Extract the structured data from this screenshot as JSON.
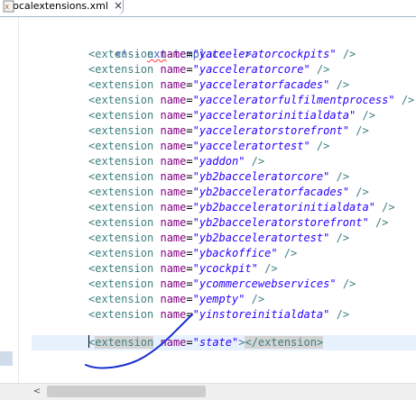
{
  "tab": {
    "title": "*localextensions.xml",
    "close": "×",
    "icon": "xml-file-icon"
  },
  "editor": {
    "comment": "<!-- ext-template -->",
    "extensions": [
      "yacceleratorcockpits",
      "yacceleratorcore",
      "yacceleratorfacades",
      "yacceleratorfulfilmentprocess",
      "yacceleratorinitialdata",
      "yacceleratorstorefront",
      "yacceleratortest",
      "yaddon",
      "yb2bacceleratorcore",
      "yb2bacceleratorfacades",
      "yb2bacceleratorinitialdata",
      "yb2bacceleratorstorefront",
      "yb2bacceleratortest",
      "ybackoffice",
      "ycockpit",
      "ycommercewebservices",
      "yempty",
      "yinstoreinitialdata"
    ],
    "current_line": {
      "tag_open": "<extension",
      "attr": "name",
      "value": "state",
      "close_tag": "</extension>"
    },
    "tokens": {
      "tag": "<extension",
      "attr": "name",
      "eq": "=",
      "self_close": " />",
      "gt": ">"
    }
  },
  "annotation": {
    "description": "hand-drawn blue stroke",
    "color": "#1a2fcf"
  },
  "scrollbar": {
    "left_arrow": "<"
  },
  "colors": {
    "comment": "#3f5fbf",
    "tag": "#3f7f7f",
    "attr": "#7f007f",
    "value": "#2a00ff",
    "current_line": "#e8f2fe"
  }
}
